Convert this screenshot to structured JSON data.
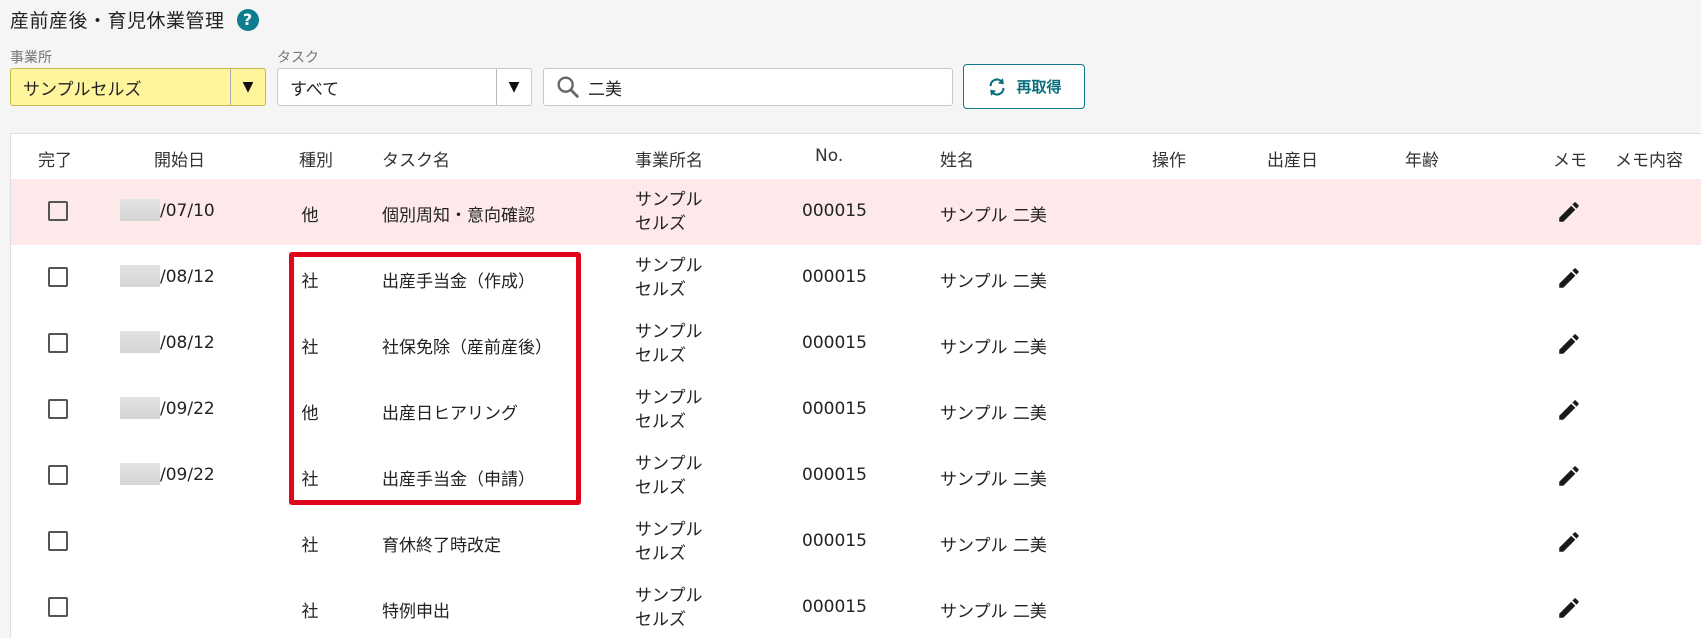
{
  "header": {
    "title": "産前産後・育児休業管理",
    "help_icon": "?"
  },
  "filters": {
    "office_label": "事業所",
    "office_value": "サンプルセルズ",
    "task_label": "タスク",
    "task_value": "すべて",
    "search_value": "二美",
    "refresh_label": "再取得"
  },
  "table": {
    "columns": [
      "完了",
      "開始日",
      "種別",
      "タスク名",
      "事業所名",
      "No.",
      "姓名",
      "操作",
      "出産日",
      "年齢",
      "メモ",
      "メモ内容"
    ],
    "rows": [
      {
        "date": "/07/10",
        "type": "他",
        "task": "個別周知・意向確認",
        "office1": "サンプル",
        "office2": "セルズ",
        "no": "000015",
        "name": "サンプル 二美"
      },
      {
        "date": "/08/12",
        "type": "社",
        "task": "出産手当金（作成）",
        "office1": "サンプル",
        "office2": "セルズ",
        "no": "000015",
        "name": "サンプル 二美"
      },
      {
        "date": "/08/12",
        "type": "社",
        "task": "社保免除（産前産後）",
        "office1": "サンプル",
        "office2": "セルズ",
        "no": "000015",
        "name": "サンプル 二美"
      },
      {
        "date": "/09/22",
        "type": "他",
        "task": "出産日ヒアリング",
        "office1": "サンプル",
        "office2": "セルズ",
        "no": "000015",
        "name": "サンプル 二美"
      },
      {
        "date": "/09/22",
        "type": "社",
        "task": "出産手当金（申請）",
        "office1": "サンプル",
        "office2": "セルズ",
        "no": "000015",
        "name": "サンプル 二美"
      },
      {
        "date": "",
        "type": "社",
        "task": "育休終了時改定",
        "office1": "サンプル",
        "office2": "セルズ",
        "no": "000015",
        "name": "サンプル 二美"
      },
      {
        "date": "",
        "type": "社",
        "task": "特例申出",
        "office1": "サンプル",
        "office2": "セルズ",
        "no": "000015",
        "name": "サンプル 二美"
      }
    ]
  },
  "colors": {
    "accent": "#0b7d8e",
    "highlight_row": "#fde8ea",
    "office_select": "#fff59d",
    "annotation": "#e0061a"
  },
  "icons": {
    "help": "help-icon",
    "dropdown": "triangle-down-icon",
    "search": "search-icon",
    "refresh": "refresh-icon",
    "memo": "pencil-icon"
  }
}
